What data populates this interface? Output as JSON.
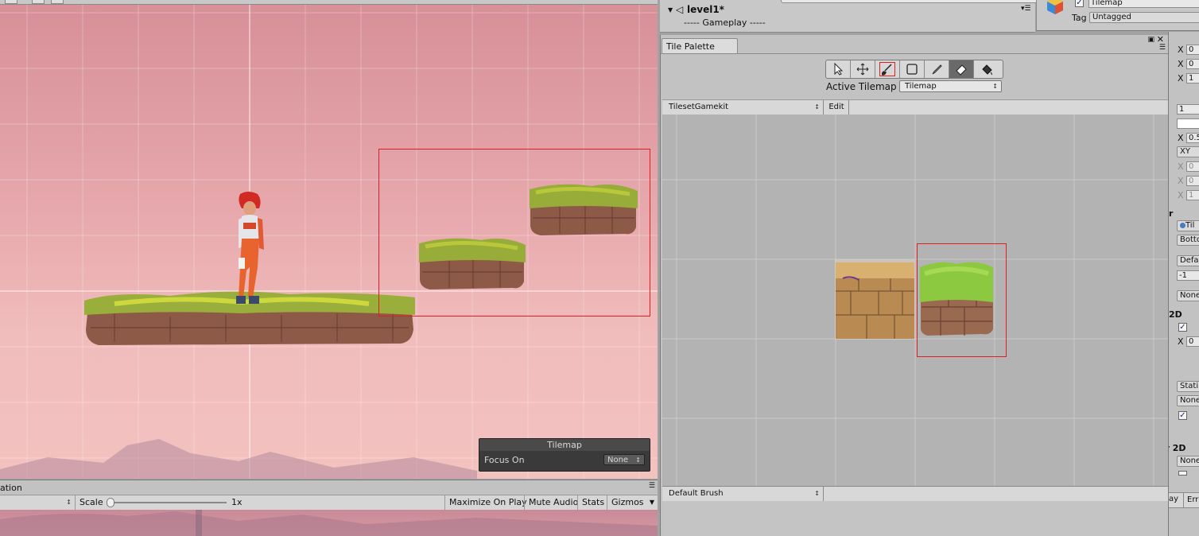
{
  "hierarchy": {
    "scene_name": "level1*",
    "child_label": "----- Gameplay -----"
  },
  "inspector_header": {
    "object_name": "Tilemap",
    "tag_label": "Tag",
    "tag_value": "Untagged"
  },
  "scene_overlay": {
    "title": "Tilemap",
    "focus_label": "Focus On",
    "focus_value": "None"
  },
  "game_view": {
    "tab_label": "ation",
    "scale_label": "Scale",
    "scale_value": "1x",
    "buttons": [
      "Maximize On Play",
      "Mute Audio",
      "Stats",
      "Gizmos"
    ]
  },
  "tile_palette": {
    "tab_label": "Tile Palette",
    "active_tilemap_label": "Active Tilemap",
    "active_tilemap_value": "Tilemap",
    "tileset": "TilesetGamekit",
    "edit_label": "Edit",
    "brush": "Default Brush",
    "tools": [
      "select-tool",
      "move-tool",
      "paint-brush-tool",
      "box-fill-tool",
      "picker-tool",
      "eraser-tool",
      "flood-fill-tool"
    ]
  },
  "inspector": {
    "rows": [
      {
        "label": "X",
        "value": "0"
      },
      {
        "label": "X",
        "value": "0"
      },
      {
        "label": "X",
        "value": "1"
      },
      {
        "label": "",
        "value": "1"
      },
      {
        "label": "",
        "value": ""
      },
      {
        "label": "X",
        "value": "0.5"
      },
      {
        "label": "",
        "value": "XY"
      },
      {
        "label": "X",
        "value": "0"
      },
      {
        "label": "X",
        "value": "0"
      },
      {
        "label": "X",
        "value": "1"
      }
    ],
    "section_r": "r",
    "tilemap_btn": "Til",
    "bottom_btn": "Botto",
    "default_btn": "Defa",
    "minus_one": "-1",
    "none1": "None",
    "section_2d": "2D",
    "x_label": "X",
    "x_zero": "0",
    "static_btn": "Stati",
    "none2": "None",
    "section_er2d": "er 2D",
    "none3": "None",
    "bottom_tabs": [
      "ay",
      "Err"
    ]
  }
}
